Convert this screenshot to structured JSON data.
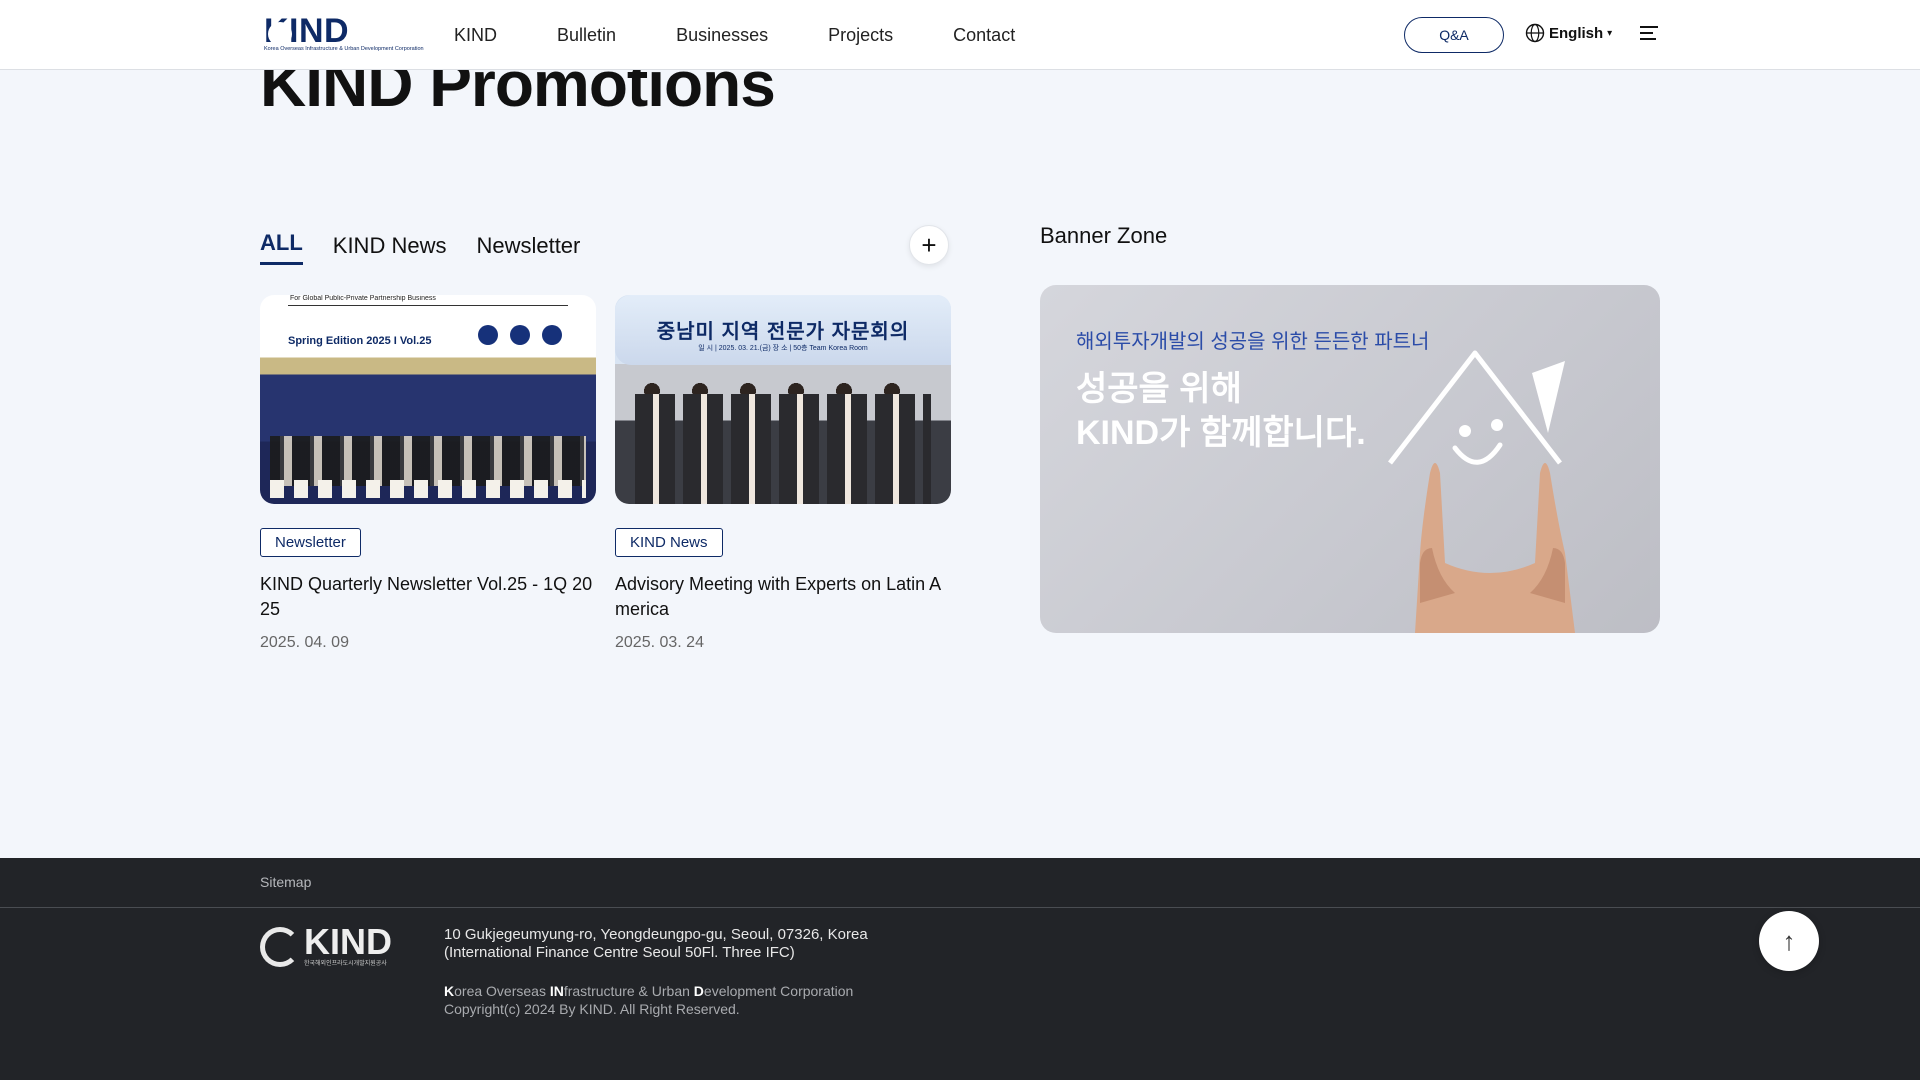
{
  "header": {
    "logo_text": "KIND",
    "logo_sub": "Korea Overseas Infrastructure & Urban Development Corporation",
    "nav": [
      "KIND",
      "Bulletin",
      "Businesses",
      "Projects",
      "Contact"
    ],
    "qa_label": "Q&A",
    "language": "English",
    "icons": {
      "globe": "globe-icon",
      "menu": "hamburger-menu-icon"
    }
  },
  "promotions": {
    "title": "KIND Promotions",
    "tabs": [
      "ALL",
      "KIND News",
      "Newsletter"
    ],
    "active_tab": "ALL",
    "more_label": "+",
    "cards": [
      {
        "badge": "Newsletter",
        "title": "KIND Quarterly Newsletter Vol.25 - 1Q 2025",
        "date": "2025. 04. 09",
        "thumb_text": "Spring Edition 2025 I Vol.25",
        "thumb_top": "For Global Public-Private Partnership Business"
      },
      {
        "badge": "KIND News",
        "title": "Advisory Meeting with Experts on Latin America",
        "date": "2025. 03. 24",
        "thumb_text": "중남미 지역 전문가 자문회의",
        "thumb_sub": "일 시 | 2025. 03. 21.(금)   장 소 | 50층 Team Korea Room"
      }
    ]
  },
  "banner_zone": {
    "heading": "Banner Zone",
    "sub": "해외투자개발의 성공을 위한 든든한 파트너",
    "main": "성공을 위해\nKIND가 함께합니다."
  },
  "footer": {
    "sitemap": "Sitemap",
    "logo_text": "KIND",
    "logo_sub": "한국해외인프라도시개발지원공사",
    "address_line1": "10 Gukjegeumyung-ro, Yeongdeungpo-gu, Seoul, 07326, Korea",
    "address_line2": "(International Finance Centre Seoul 50Fl. Three IFC)",
    "corp_parts": [
      {
        "b": "K",
        "t": "orea Overseas "
      },
      {
        "b": "IN",
        "t": "frastructure & Urban "
      },
      {
        "b": "D",
        "t": "evelopment Corporation"
      }
    ],
    "copyright": "Copyright(c) 2024 By KIND. All Right Reserved.",
    "top_button": "↑"
  },
  "colors": {
    "brand": "#0e2a66",
    "bg": "#f3f6fb",
    "footer": "#222428",
    "accent_text": "#2b4ca8"
  }
}
